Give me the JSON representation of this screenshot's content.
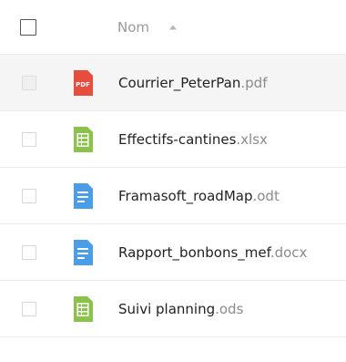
{
  "header": {
    "name_label": "Nom",
    "sort_icon": "sort-ascending-icon"
  },
  "files": [
    {
      "base": "Courrier_PeterPan",
      "ext": ".pdf",
      "type": "pdf",
      "icon_label": "PDF",
      "color": "#e74c3c",
      "selected": true
    },
    {
      "base": "Effectifs-cantines",
      "ext": ".xlsx",
      "type": "spreadsheet",
      "color": "#8bc34a"
    },
    {
      "base": "Framasoft_roadMap",
      "ext": ".odt",
      "type": "document",
      "color": "#4a9ee8"
    },
    {
      "base": "Rapport_bonbons_mef",
      "ext": ".docx",
      "type": "document",
      "color": "#4a9ee8"
    },
    {
      "base": "Suivi planning",
      "ext": ".ods",
      "type": "spreadsheet",
      "color": "#8bc34a"
    }
  ]
}
